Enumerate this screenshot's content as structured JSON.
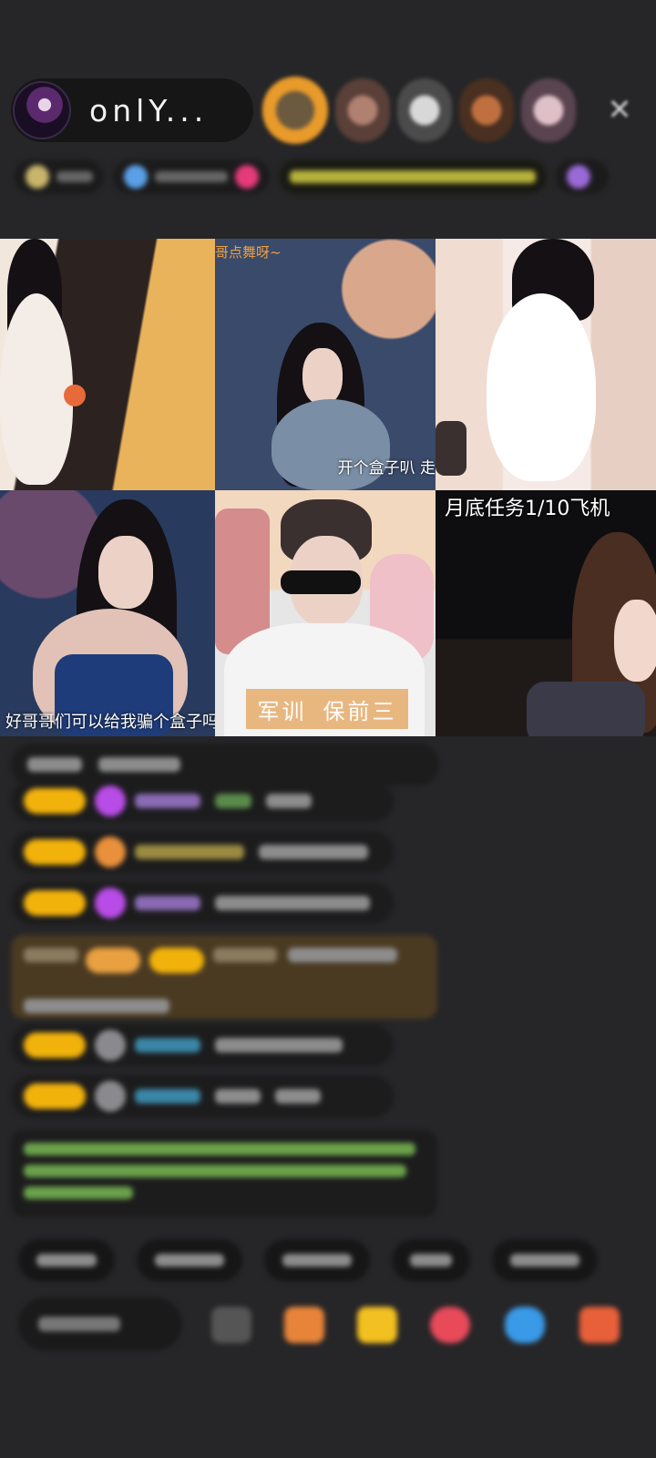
{
  "header": {
    "host_name": "onlY...",
    "host_avatar_icon": "avatar",
    "viewer_avatars": [
      "viewer-1",
      "viewer-2",
      "viewer-3",
      "viewer-4",
      "viewer-5"
    ],
    "close_icon": "close-icon"
  },
  "grid": {
    "tiles": [
      {
        "caption": ""
      },
      {
        "caption_top": "哥点舞呀~",
        "caption_bottom": "开个盒子叭 走"
      },
      {
        "caption": ""
      },
      {
        "caption_bottom": "好哥哥们可以给我骗个盒子吗"
      },
      {
        "banner_left": "军训",
        "banner_right": "保前三"
      },
      {
        "caption_top": "月底任务1/10飞机"
      }
    ]
  },
  "colors": {
    "background": "#262628",
    "badge_yellow": "#f2b20c",
    "tag_orange": "#f0a040",
    "chat_bubble": "#1c1c1d"
  }
}
